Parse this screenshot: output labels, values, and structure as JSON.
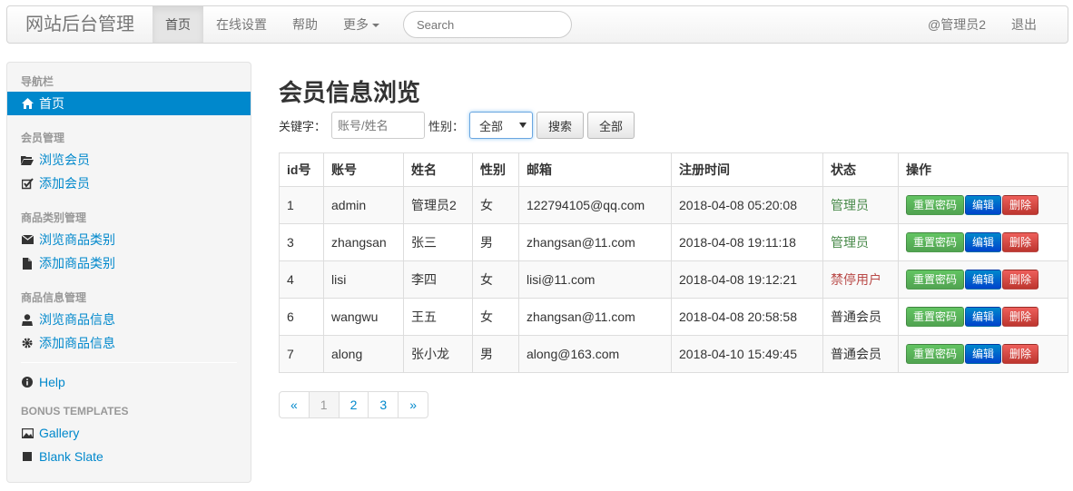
{
  "navbar": {
    "brand": "网站后台管理",
    "items": [
      {
        "label": "首页",
        "active": true
      },
      {
        "label": "在线设置"
      },
      {
        "label": "帮助"
      },
      {
        "label": "更多"
      }
    ],
    "search_placeholder": "Search",
    "user": "@管理员2",
    "logout": "退出"
  },
  "sidebar": {
    "nav_header": "导航栏",
    "home": "首页",
    "member_header": "会员管理",
    "browse_member": "浏览会员",
    "add_member": "添加会员",
    "category_header": "商品类别管理",
    "browse_category": "浏览商品类别",
    "add_category": "添加商品类别",
    "goods_header": "商品信息管理",
    "browse_goods": "浏览商品信息",
    "add_goods": "添加商品信息",
    "help": "Help",
    "bonus_header": "BONUS TEMPLATES",
    "gallery": "Gallery",
    "blank_slate": "Blank Slate"
  },
  "main": {
    "title": "会员信息浏览",
    "filter": {
      "keyword_label": "关键字：",
      "keyword_placeholder": "账号/姓名",
      "gender_label": "性别：",
      "gender_value": "全部",
      "search_button": "搜索",
      "all_button": "全部"
    },
    "columns": {
      "id": "id号",
      "account": "账号",
      "name": "姓名",
      "gender": "性别",
      "email": "邮箱",
      "reg_time": "注册时间",
      "status": "状态",
      "ops": "操作"
    },
    "rows": [
      {
        "id": "1",
        "account": "admin",
        "name": "管理员2",
        "gender": "女",
        "email": "122794105@qq.com",
        "reg_time": "2018-04-08 05:20:08",
        "status": "管理员"
      },
      {
        "id": "3",
        "account": "zhangsan",
        "name": "张三",
        "gender": "男",
        "email": "zhangsan@11.com",
        "reg_time": "2018-04-08 19:11:18",
        "status": "管理员"
      },
      {
        "id": "4",
        "account": "lisi",
        "name": "李四",
        "gender": "女",
        "email": "lisi@11.com",
        "reg_time": "2018-04-08 19:12:21",
        "status": "禁停用户"
      },
      {
        "id": "6",
        "account": "wangwu",
        "name": "王五",
        "gender": "女",
        "email": "zhangsan@11.com",
        "reg_time": "2018-04-08 20:58:58",
        "status": "普通会员"
      },
      {
        "id": "7",
        "account": "along",
        "name": "张小龙",
        "gender": "男",
        "email": "along@163.com",
        "reg_time": "2018-04-10 15:49:45",
        "status": "普通会员"
      }
    ],
    "row_buttons": {
      "reset": "重置密码",
      "edit": "编辑",
      "delete": "删除"
    },
    "pager": {
      "prev": "«",
      "pages": [
        "1",
        "2",
        "3"
      ],
      "next": "»",
      "current": "1"
    }
  },
  "colors": {
    "accent": "#0088cc",
    "admin_status": "#468847",
    "banned_status": "#b94a48"
  }
}
